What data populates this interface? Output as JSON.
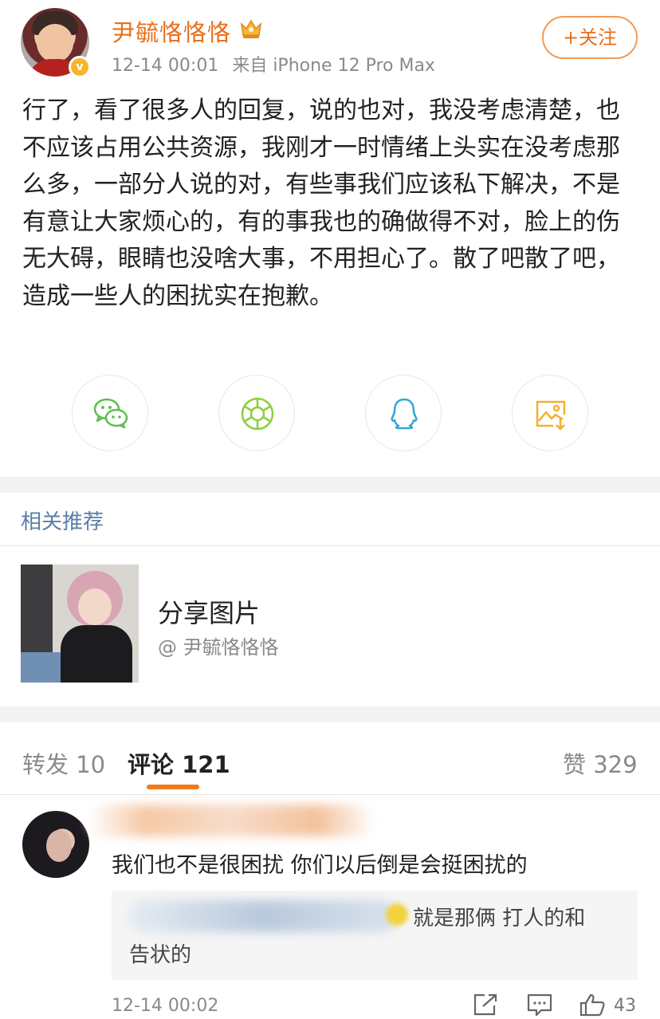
{
  "post": {
    "username": "尹毓恪恪恪",
    "time": "12-14 00:01",
    "source": "来自 iPhone 12 Pro Max",
    "follow_label": "+关注",
    "verified_mark": "v",
    "body": "行了，看了很多人的回复，说的也对，我没考虑清楚，也不应该占用公共资源，我刚才一时情绪上头实在没考虑那么多，一部分人说的对，有些事我们应该私下解决，不是有意让大家烦心的，有的事我也的确做得不对，脸上的伤无大碍，眼睛也没啥大事，不用担心了。散了吧散了吧，造成一些人的困扰实在抱歉。"
  },
  "share_icons": [
    "wechat-icon",
    "moments-icon",
    "qq-icon",
    "save-image-icon"
  ],
  "colors": {
    "username": "#e96f1a",
    "accent": "#f07b1d",
    "link_blue": "#5a7ea6",
    "wechat_green": "#5bbf4e",
    "moments_green": "#8ccf3c",
    "qq_blue": "#33a6d8",
    "save_yellow": "#f2b02d"
  },
  "related": {
    "title": "相关推荐",
    "item_title": "分享图片",
    "item_author": "@ 尹毓恪恪恪"
  },
  "tabs": {
    "repost": "转发 10",
    "comments": "评论 121",
    "likes": "赞 329"
  },
  "comment": {
    "text": "我们也不是很困扰 你们以后倒是会挺困扰的",
    "quote_line1": "就是那俩 打人的和",
    "quote_line2": "告状的",
    "time": "12-14 00:02",
    "like_count": "43"
  }
}
